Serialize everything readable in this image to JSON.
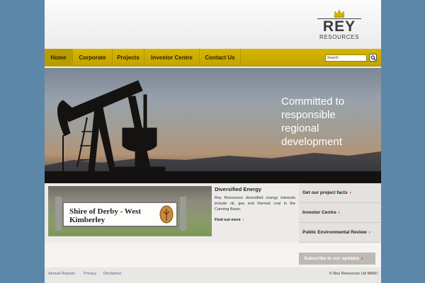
{
  "brand": {
    "name": "REY",
    "sub": "RESOURCES",
    "crown_icon": "crown-icon"
  },
  "nav": {
    "items": [
      {
        "label": "Home",
        "active": true
      },
      {
        "label": "Corporate",
        "active": false
      },
      {
        "label": "Projects",
        "active": false
      },
      {
        "label": "Investor Centre",
        "active": false
      },
      {
        "label": "Contact Us",
        "active": false
      }
    ]
  },
  "search": {
    "value": "Search",
    "button_icon": "search-icon"
  },
  "hero": {
    "line1": "Committed to",
    "line2": "responsible",
    "line3": "regional",
    "line4": "development"
  },
  "photo": {
    "sign_text": "Shire of Derby - West Kimberley"
  },
  "feature": {
    "title": "Diversified Energy",
    "description": "Rey Resources diversified energy interests include oil, gas and thermal coal in the Canning Basin.",
    "link": "Find out more"
  },
  "side_links": [
    {
      "label": "Get our project facts"
    },
    {
      "label": "Investor Centre"
    },
    {
      "label": "Public Environmental Review"
    }
  ],
  "subscribe": {
    "label": "Subscribe to our updates"
  },
  "footer": {
    "links": [
      "Annual Reports",
      "Privacy",
      "Disclaimer"
    ],
    "copyright": "© Rey Resources Ltd MMXI"
  },
  "colors": {
    "background": "#5d87a8",
    "nav": "#cdb000",
    "accent_red": "#c3161b",
    "link_blue": "#4a6a92"
  }
}
